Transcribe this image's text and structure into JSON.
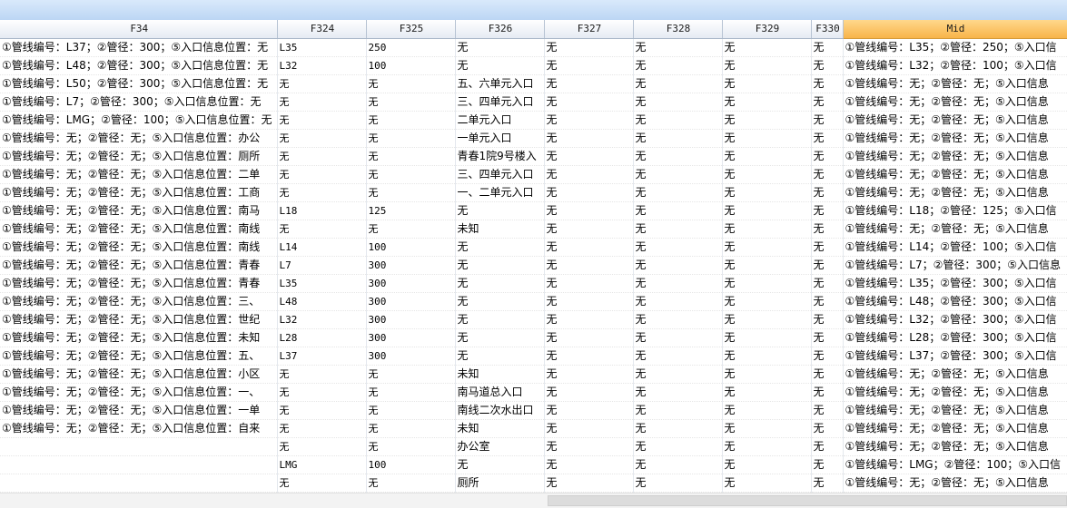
{
  "grid": {
    "columns": [
      {
        "key": "F34",
        "label": "F34",
        "active": false
      },
      {
        "key": "F324",
        "label": "F324",
        "active": false
      },
      {
        "key": "F325",
        "label": "F325",
        "active": false
      },
      {
        "key": "F326",
        "label": "F326",
        "active": false
      },
      {
        "key": "F327",
        "label": "F327",
        "active": false
      },
      {
        "key": "F328",
        "label": "F328",
        "active": false
      },
      {
        "key": "F329",
        "label": "F329",
        "active": false
      },
      {
        "key": "F330",
        "label": "F330",
        "active": false
      },
      {
        "key": "Mid",
        "label": "Mid",
        "active": true
      }
    ],
    "rows": [
      [
        "①管线编号：L37；②管径：300；⑤入口信息位置：无",
        "L35",
        "250",
        "无",
        "无",
        "无",
        "无",
        "无",
        "①管线编号：L35；②管径：250；⑤入口信"
      ],
      [
        "①管线编号：L48；②管径：300；⑤入口信息位置：无",
        "L32",
        "100",
        "无",
        "无",
        "无",
        "无",
        "无",
        "①管线编号：L32；②管径：100；⑤入口信"
      ],
      [
        "①管线编号：L50；②管径：300；⑤入口信息位置：无",
        "无",
        "无",
        "五、六单元入口",
        "无",
        "无",
        "无",
        "无",
        "①管线编号：无；②管径：无；⑤入口信息"
      ],
      [
        "①管线编号：L7；②管径：300；⑤入口信息位置：无",
        "无",
        "无",
        "三、四单元入口",
        "无",
        "无",
        "无",
        "无",
        "①管线编号：无；②管径：无；⑤入口信息"
      ],
      [
        "①管线编号：LMG；②管径：100；⑤入口信息位置：无",
        "无",
        "无",
        "二单元入口",
        "无",
        "无",
        "无",
        "无",
        "①管线编号：无；②管径：无；⑤入口信息"
      ],
      [
        "①管线编号：无；②管径：无；⑤入口信息位置：办公",
        "无",
        "无",
        "一单元入口",
        "无",
        "无",
        "无",
        "无",
        "①管线编号：无；②管径：无；⑤入口信息"
      ],
      [
        "①管线编号：无；②管径：无；⑤入口信息位置：厕所",
        "无",
        "无",
        "青春1院9号楼入",
        "无",
        "无",
        "无",
        "无",
        "①管线编号：无；②管径：无；⑤入口信息"
      ],
      [
        "①管线编号：无；②管径：无；⑤入口信息位置：二单",
        "无",
        "无",
        "三、四单元入口",
        "无",
        "无",
        "无",
        "无",
        "①管线编号：无；②管径：无；⑤入口信息"
      ],
      [
        "①管线编号：无；②管径：无；⑤入口信息位置：工商",
        "无",
        "无",
        "一、二单元入口",
        "无",
        "无",
        "无",
        "无",
        "①管线编号：无；②管径：无；⑤入口信息"
      ],
      [
        "①管线编号：无；②管径：无；⑤入口信息位置：南马",
        "L18",
        "125",
        "无",
        "无",
        "无",
        "无",
        "无",
        "①管线编号：L18；②管径：125；⑤入口信"
      ],
      [
        "①管线编号：无；②管径：无；⑤入口信息位置：南线",
        "无",
        "无",
        "未知",
        "无",
        "无",
        "无",
        "无",
        "①管线编号：无；②管径：无；⑤入口信息"
      ],
      [
        "①管线编号：无；②管径：无；⑤入口信息位置：南线",
        "L14",
        "100",
        "无",
        "无",
        "无",
        "无",
        "无",
        "①管线编号：L14；②管径：100；⑤入口信"
      ],
      [
        "①管线编号：无；②管径：无；⑤入口信息位置：青春",
        "L7",
        "300",
        "无",
        "无",
        "无",
        "无",
        "无",
        "①管线编号：L7；②管径：300；⑤入口信息"
      ],
      [
        "①管线编号：无；②管径：无；⑤入口信息位置：青春",
        "L35",
        "300",
        "无",
        "无",
        "无",
        "无",
        "无",
        "①管线编号：L35；②管径：300；⑤入口信"
      ],
      [
        "①管线编号：无；②管径：无；⑤入口信息位置：三、",
        "L48",
        "300",
        "无",
        "无",
        "无",
        "无",
        "无",
        "①管线编号：L48；②管径：300；⑤入口信"
      ],
      [
        "①管线编号：无；②管径：无；⑤入口信息位置：世纪",
        "L32",
        "300",
        "无",
        "无",
        "无",
        "无",
        "无",
        "①管线编号：L32；②管径：300；⑤入口信"
      ],
      [
        "①管线编号：无；②管径：无；⑤入口信息位置：未知",
        "L28",
        "300",
        "无",
        "无",
        "无",
        "无",
        "无",
        "①管线编号：L28；②管径：300；⑤入口信"
      ],
      [
        "①管线编号：无；②管径：无；⑤入口信息位置：五、",
        "L37",
        "300",
        "无",
        "无",
        "无",
        "无",
        "无",
        "①管线编号：L37；②管径：300；⑤入口信"
      ],
      [
        "①管线编号：无；②管径：无；⑤入口信息位置：小区",
        "无",
        "无",
        "未知",
        "无",
        "无",
        "无",
        "无",
        "①管线编号：无；②管径：无；⑤入口信息"
      ],
      [
        "①管线编号：无；②管径：无；⑤入口信息位置：一、",
        "无",
        "无",
        "南马道总入口",
        "无",
        "无",
        "无",
        "无",
        "①管线编号：无；②管径：无；⑤入口信息"
      ],
      [
        "①管线编号：无；②管径：无；⑤入口信息位置：一单",
        "无",
        "无",
        "南线二次水出口",
        "无",
        "无",
        "无",
        "无",
        "①管线编号：无；②管径：无；⑤入口信息"
      ],
      [
        "①管线编号：无；②管径：无；⑤入口信息位置：自来",
        "无",
        "无",
        "未知",
        "无",
        "无",
        "无",
        "无",
        "①管线编号：无；②管径：无；⑤入口信息"
      ],
      [
        "",
        "无",
        "无",
        "办公室",
        "无",
        "无",
        "无",
        "无",
        "①管线编号：无；②管径：无；⑤入口信息"
      ],
      [
        "",
        "LMG",
        "100",
        "无",
        "无",
        "无",
        "无",
        "无",
        "①管线编号：LMG；②管径：100；⑤入口信"
      ],
      [
        "",
        "无",
        "无",
        "厕所",
        "无",
        "无",
        "无",
        "无",
        "①管线编号：无；②管径：无；⑤入口信息"
      ]
    ]
  }
}
